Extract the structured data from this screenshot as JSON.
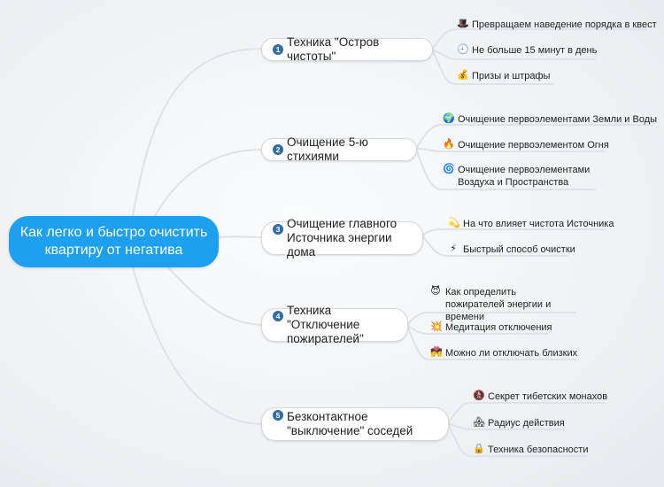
{
  "central": {
    "label": "Как легко и быстро очистить квартиру от негатива"
  },
  "colors": {
    "central": "#1ea0f0",
    "connector": "#dfe2e6",
    "number_badge": "#2f6ea5"
  },
  "branches": [
    {
      "number": "1",
      "label": "Техника \"Остров чистоты\"",
      "leaves": [
        {
          "icon": "top-hat-icon",
          "glyph": "🎩",
          "label": "Превращаем наведение порядка в квест"
        },
        {
          "icon": "clock-icon",
          "glyph": "🕘",
          "label": "Не больше 15 минут в день"
        },
        {
          "icon": "money-bag-icon",
          "glyph": "💰",
          "label": "Призы и штрафы"
        }
      ]
    },
    {
      "number": "2",
      "label": "Очищение 5-ю стихиями",
      "leaves": [
        {
          "icon": "globe-icon",
          "glyph": "🌍",
          "label": "Очищение первоэлементами Земли и Воды"
        },
        {
          "icon": "fire-icon",
          "glyph": "🔥",
          "label": "Очищение первоэлементом Огня"
        },
        {
          "icon": "cyclone-icon",
          "glyph": "🌀",
          "label": "Очищение первоэлементами Воздуха и Пространства"
        }
      ]
    },
    {
      "number": "3",
      "label": "Очищение главного Источника энергии дома",
      "leaves": [
        {
          "icon": "dizzy-icon",
          "glyph": "💫",
          "label": "На что влияет чистота Источника"
        },
        {
          "icon": "lightning-icon",
          "glyph": "⚡",
          "label": "Быстрый способ очистки"
        }
      ]
    },
    {
      "number": "4",
      "label": "Техника \"Отключение пожирателей\"",
      "leaves": [
        {
          "icon": "devil-icon",
          "glyph": "😈",
          "label": "Как определить пожирателей энергии и времени"
        },
        {
          "icon": "explosion-icon",
          "glyph": "💥",
          "label": "Медитация отключения"
        },
        {
          "icon": "couple-icon",
          "glyph": "💏",
          "label": "Можно ли отключать близких"
        }
      ]
    },
    {
      "number": "5",
      "label": "Безконтактное \"выключение\" соседей",
      "leaves": [
        {
          "icon": "no-pedestrians-icon",
          "glyph": "🚷",
          "label": "Секрет тибетских монахов"
        },
        {
          "icon": "house-icon",
          "glyph": "🏘",
          "label": "Радиус действия"
        },
        {
          "icon": "lock-icon",
          "glyph": "🔒",
          "label": "Техника безопасности"
        }
      ]
    }
  ]
}
